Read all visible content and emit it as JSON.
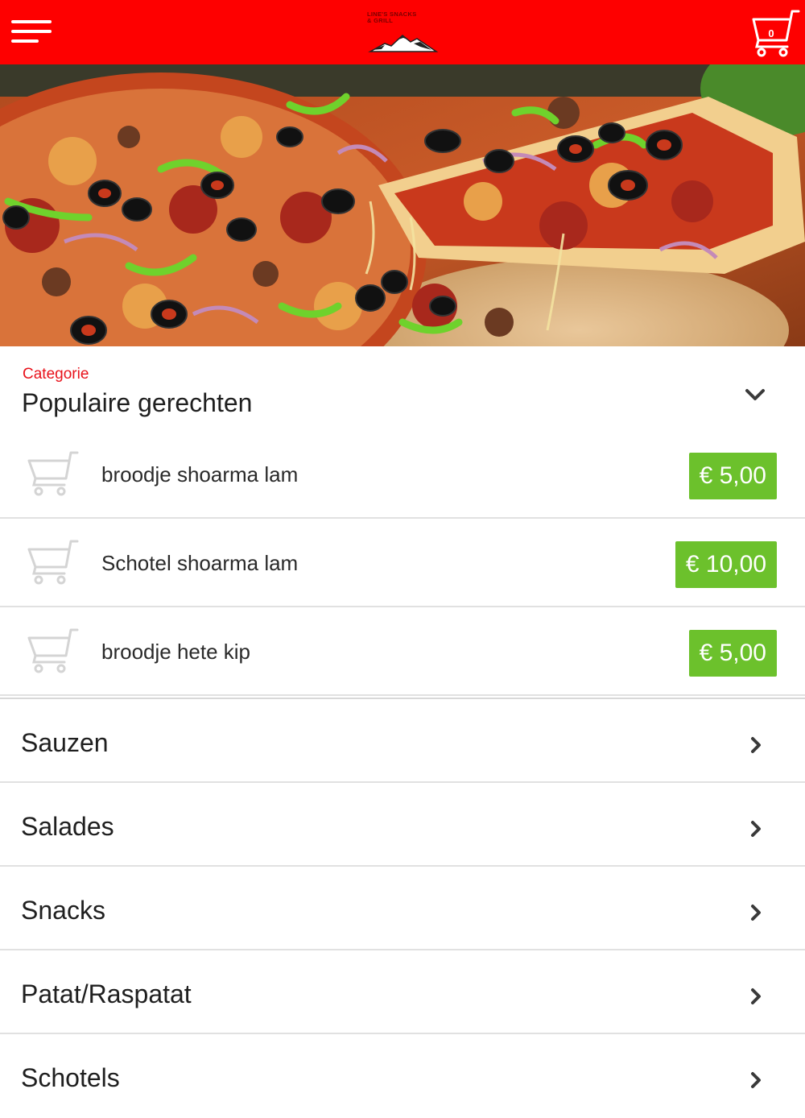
{
  "header": {
    "menu_icon": "hamburger-menu-icon",
    "logo_text": "LINE'S SNACKS\n& GRILL",
    "cart_count": "0",
    "cart_icon": "shopping-cart-icon",
    "colors": {
      "bar": "#fe0000"
    }
  },
  "hero": {
    "image": "pizza-photo"
  },
  "category": {
    "label": "Categorie",
    "title": "Populaire gerechten",
    "toggle_icon": "chevron-down-icon",
    "label_color": "#e8121b"
  },
  "products": [
    {
      "name": "broodje shoarma lam",
      "price": "€ 5,00"
    },
    {
      "name": "Schotel shoarma lam",
      "price": "€ 10,00"
    },
    {
      "name": "broodje hete kip",
      "price": "€ 5,00"
    }
  ],
  "price_color": "#6cc12c",
  "categories": [
    {
      "name": "Sauzen",
      "icon": "chevron-right-icon"
    },
    {
      "name": "Salades",
      "icon": "chevron-right-icon"
    },
    {
      "name": "Snacks",
      "icon": "chevron-right-icon"
    },
    {
      "name": "Patat/Raspatat",
      "icon": "chevron-right-icon"
    },
    {
      "name": "Schotels",
      "icon": "chevron-right-icon"
    }
  ]
}
